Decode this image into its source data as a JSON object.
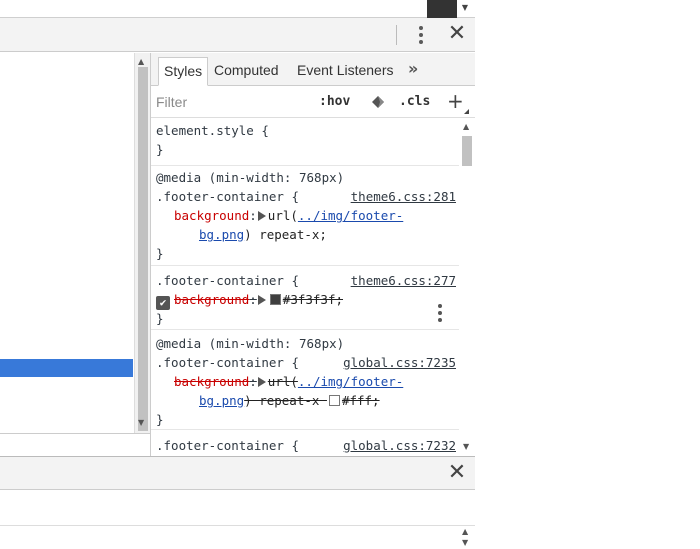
{
  "toolbar": {
    "close_glyph": "✕"
  },
  "sidebar": {
    "tabs": [
      {
        "label": "Styles",
        "active": true
      },
      {
        "label": "Computed",
        "active": false
      },
      {
        "label": "Event Listeners",
        "active": false
      }
    ],
    "more_tabs_glyph": "»",
    "filter": {
      "placeholder": "Filter",
      "value": ""
    },
    "hov_label": ":hov",
    "cls_label": ".cls",
    "add_rule_glyph": "+"
  },
  "styles": {
    "element_style": {
      "selector": "element.style {",
      "close": "}"
    },
    "rule1": {
      "media": "@media (min-width: 768px)",
      "selector": ".footer-container {",
      "source": "theme6.css:281",
      "property": "background",
      "value_prefix": "url(",
      "link_part1": "../img/footer-",
      "link_part2": "bg.png",
      "value_suffix": ") repeat-x;",
      "close": "}"
    },
    "rule2": {
      "selector": ".footer-container {",
      "source": "theme6.css:277",
      "property": "background",
      "value": "#3f3f3f;",
      "swatch_color": "#3f3f3f",
      "checked": true,
      "close": "}"
    },
    "rule3": {
      "media": "@media (min-width: 768px)",
      "selector": ".footer-container {",
      "source": "global.css:7235",
      "property": "background",
      "value_prefix": "url(",
      "link_part1": "../img/footer-",
      "link_part2": "bg.png",
      "value_mid": ") repeat-x ",
      "value_end": "#fff;",
      "swatch_color": "#ffffff",
      "close": "}"
    },
    "rule4": {
      "selector": ".footer-container {",
      "source": "global.css:7232"
    }
  },
  "drawer": {
    "close_glyph": "✕"
  },
  "colors": {
    "selection": "#3879d9",
    "property_name": "#c80000",
    "link": "#1a4aad",
    "toolbar_bg": "#f3f3f3"
  }
}
